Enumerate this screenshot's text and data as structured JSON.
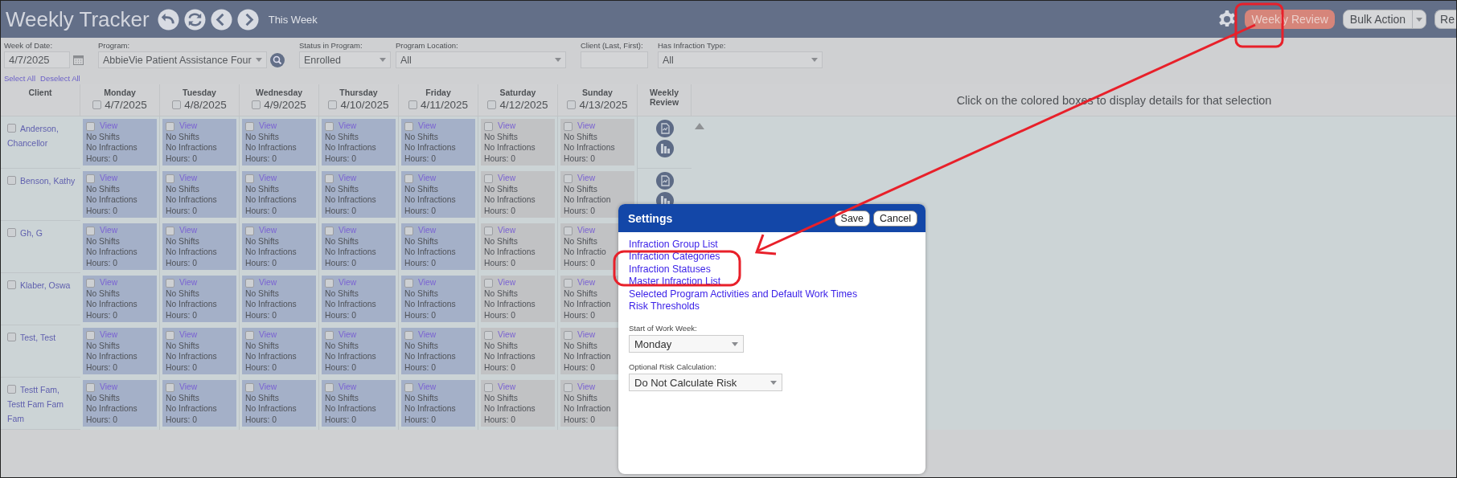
{
  "header": {
    "title": "Weekly Tracker",
    "this_week": "This Week",
    "weekly_review": "Weekly Review",
    "bulk_action": "Bulk Action",
    "cut_button": "Re"
  },
  "filters": {
    "week_of_date": {
      "label": "Week of Date:",
      "value": "4/7/2025"
    },
    "program": {
      "label": "Program:",
      "value": "AbbieVie Patient Assistance Four"
    },
    "status": {
      "label": "Status in Program:",
      "value": "Enrolled"
    },
    "location": {
      "label": "Program Location:",
      "value": "All"
    },
    "client": {
      "label": "Client (Last, First):"
    },
    "infraction_type": {
      "label": "Has Infraction Type:",
      "value": "All"
    },
    "select_all": "Select All",
    "deselect_all": "Deselect All"
  },
  "grid": {
    "client_heading": "Client",
    "review_heading": "Weekly Review",
    "days": [
      {
        "name": "Monday",
        "date": "4/7/2025",
        "checked": false,
        "kind": "weekday"
      },
      {
        "name": "Tuesday",
        "date": "4/8/2025",
        "checked": false,
        "kind": "weekday"
      },
      {
        "name": "Wednesday",
        "date": "4/9/2025",
        "checked": false,
        "kind": "weekday"
      },
      {
        "name": "Thursday",
        "date": "4/10/2025",
        "checked": false,
        "kind": "weekday"
      },
      {
        "name": "Friday",
        "date": "4/11/2025",
        "checked": false,
        "kind": "weekday"
      },
      {
        "name": "Saturday",
        "date": "4/12/2025",
        "checked": false,
        "kind": "weekend"
      },
      {
        "name": "Sunday",
        "date": "4/13/2025",
        "checked": false,
        "kind": "weekend"
      }
    ],
    "rows": [
      {
        "client": "Anderson, Chancellor",
        "checked": false,
        "review_icons": true,
        "cells": [
          {
            "checked": false,
            "link": "View",
            "shifts": "No Shifts",
            "infractions": "No Infractions",
            "hours": "Hours: 0"
          },
          {
            "checked": false,
            "link": "View",
            "shifts": "No Shifts",
            "infractions": "No Infractions",
            "hours": "Hours: 0"
          },
          {
            "checked": false,
            "link": "View",
            "shifts": "No Shifts",
            "infractions": "No Infractions",
            "hours": "Hours: 0"
          },
          {
            "checked": false,
            "link": "View",
            "shifts": "No Shifts",
            "infractions": "No Infractions",
            "hours": "Hours: 0"
          },
          {
            "checked": false,
            "link": "View",
            "shifts": "No Shifts",
            "infractions": "No Infractions",
            "hours": "Hours: 0"
          },
          {
            "checked": false,
            "link": "View",
            "shifts": "No Shifts",
            "infractions": "No Infractions",
            "hours": "Hours: 0"
          },
          {
            "checked": false,
            "link": "View",
            "shifts": "No Shifts",
            "infractions": "No Infractions",
            "hours": "Hours: 0"
          }
        ]
      },
      {
        "client": "Benson, Kathy",
        "checked": false,
        "review_icons": true,
        "cells": [
          {
            "checked": false,
            "link": "View",
            "shifts": "No Shifts",
            "infractions": "No Infractions",
            "hours": "Hours: 0"
          },
          {
            "checked": false,
            "link": "View",
            "shifts": "No Shifts",
            "infractions": "No Infractions",
            "hours": "Hours: 0"
          },
          {
            "checked": false,
            "link": "View",
            "shifts": "No Shifts",
            "infractions": "No Infractions",
            "hours": "Hours: 0"
          },
          {
            "checked": false,
            "link": "View",
            "shifts": "No Shifts",
            "infractions": "No Infractions",
            "hours": "Hours: 0"
          },
          {
            "checked": false,
            "link": "View",
            "shifts": "No Shifts",
            "infractions": "No Infractions",
            "hours": "Hours: 0"
          },
          {
            "checked": false,
            "link": "View",
            "shifts": "No Shifts",
            "infractions": "No Infractions",
            "hours": "Hours: 0"
          },
          {
            "checked": false,
            "link": "View",
            "shifts": "No Shifts",
            "infractions": "No Infraction",
            "hours": "Hours: 0"
          }
        ]
      },
      {
        "client": "Gh, G",
        "checked": false,
        "cells": [
          {
            "checked": false,
            "link": "View",
            "shifts": "No Shifts",
            "infractions": "No Infractions",
            "hours": "Hours: 0"
          },
          {
            "checked": false,
            "link": "View",
            "shifts": "No Shifts",
            "infractions": "No Infractions",
            "hours": "Hours: 0"
          },
          {
            "checked": false,
            "link": "View",
            "shifts": "No Shifts",
            "infractions": "No Infractions",
            "hours": "Hours: 0"
          },
          {
            "checked": false,
            "link": "View",
            "shifts": "No Shifts",
            "infractions": "No Infractions",
            "hours": "Hours: 0"
          },
          {
            "checked": false,
            "link": "View",
            "shifts": "No Shifts",
            "infractions": "No Infractions",
            "hours": "Hours: 0"
          },
          {
            "checked": false,
            "link": "View",
            "shifts": "No Shifts",
            "infractions": "No Infractions",
            "hours": "Hours: 0"
          },
          {
            "checked": false,
            "link": "View",
            "shifts": "No Shifts",
            "infractions": "No Infractio",
            "hours": "Hours: 0"
          }
        ]
      },
      {
        "client": "Klaber, Oswa",
        "checked": false,
        "cells": [
          {
            "checked": false,
            "link": "View",
            "shifts": "No Shifts",
            "infractions": "No Infractions",
            "hours": "Hours: 0"
          },
          {
            "checked": false,
            "link": "View",
            "shifts": "No Shifts",
            "infractions": "No Infractions",
            "hours": "Hours: 0"
          },
          {
            "checked": false,
            "link": "View",
            "shifts": "No Shifts",
            "infractions": "No Infractions",
            "hours": "Hours: 0"
          },
          {
            "checked": false,
            "link": "View",
            "shifts": "No Shifts",
            "infractions": "No Infractions",
            "hours": "Hours: 0"
          },
          {
            "checked": false,
            "link": "View",
            "shifts": "No Shifts",
            "infractions": "No Infractions",
            "hours": "Hours: 0"
          },
          {
            "checked": false,
            "link": "View",
            "shifts": "No Shifts",
            "infractions": "No Infractions",
            "hours": "Hours: 0"
          },
          {
            "checked": false,
            "link": "View",
            "shifts": "No Shifts",
            "infractions": "No Infraction",
            "hours": "Hours: 0"
          }
        ]
      },
      {
        "client": "Test, Test",
        "checked": false,
        "cells": [
          {
            "checked": false,
            "link": "View",
            "shifts": "No Shifts",
            "infractions": "No Infractions",
            "hours": "Hours: 0"
          },
          {
            "checked": false,
            "link": "View",
            "shifts": "No Shifts",
            "infractions": "No Infractions",
            "hours": "Hours: 0"
          },
          {
            "checked": false,
            "link": "View",
            "shifts": "No Shifts",
            "infractions": "No Infractions",
            "hours": "Hours: 0"
          },
          {
            "checked": false,
            "link": "View",
            "shifts": "No Shifts",
            "infractions": "No Infractions",
            "hours": "Hours: 0"
          },
          {
            "checked": false,
            "link": "View",
            "shifts": "No Shifts",
            "infractions": "No Infractions",
            "hours": "Hours: 0"
          },
          {
            "checked": false,
            "link": "View",
            "shifts": "No Shifts",
            "infractions": "No Infractions",
            "hours": "Hours: 0"
          },
          {
            "checked": false,
            "link": "View",
            "shifts": "No Shifts",
            "infractions": "No Infraction",
            "hours": "Hours: 0"
          }
        ]
      },
      {
        "client": "Testt Fam, Testt Fam Fam Fam",
        "checked": false,
        "cells": [
          {
            "checked": false,
            "link": "View",
            "shifts": "No Shifts",
            "infractions": "No Infractions",
            "hours": "Hours: 0"
          },
          {
            "checked": false,
            "link": "View",
            "shifts": "No Shifts",
            "infractions": "No Infractions",
            "hours": "Hours: 0"
          },
          {
            "checked": false,
            "link": "View",
            "shifts": "No Shifts",
            "infractions": "No Infractions",
            "hours": "Hours: 0"
          },
          {
            "checked": false,
            "link": "View",
            "shifts": "No Shifts",
            "infractions": "No Infractions",
            "hours": "Hours: 0"
          },
          {
            "checked": false,
            "link": "View",
            "shifts": "No Shifts",
            "infractions": "No Infractions",
            "hours": "Hours: 0"
          },
          {
            "checked": false,
            "link": "View",
            "shifts": "No Shifts",
            "infractions": "No Infractions",
            "hours": "Hours: 0"
          },
          {
            "checked": false,
            "link": "View",
            "shifts": "No Shifts",
            "infractions": "No Infraction",
            "hours": "Hours: 0"
          }
        ]
      }
    ]
  },
  "detail_hint": "Click on the colored boxes to display details for that selection",
  "settings": {
    "title": "Settings",
    "save": "Save",
    "cancel": "Cancel",
    "links": [
      "Infraction Group List",
      "Infraction Categories",
      "Infraction Statuses",
      "Master Infraction List",
      "Selected Program Activities and Default Work Times",
      "Risk Thresholds"
    ],
    "start_week": {
      "label": "Start of Work Week:",
      "value": "Monday"
    },
    "risk": {
      "label": "Optional Risk Calculation:",
      "value": "Do Not Calculate Risk"
    }
  }
}
